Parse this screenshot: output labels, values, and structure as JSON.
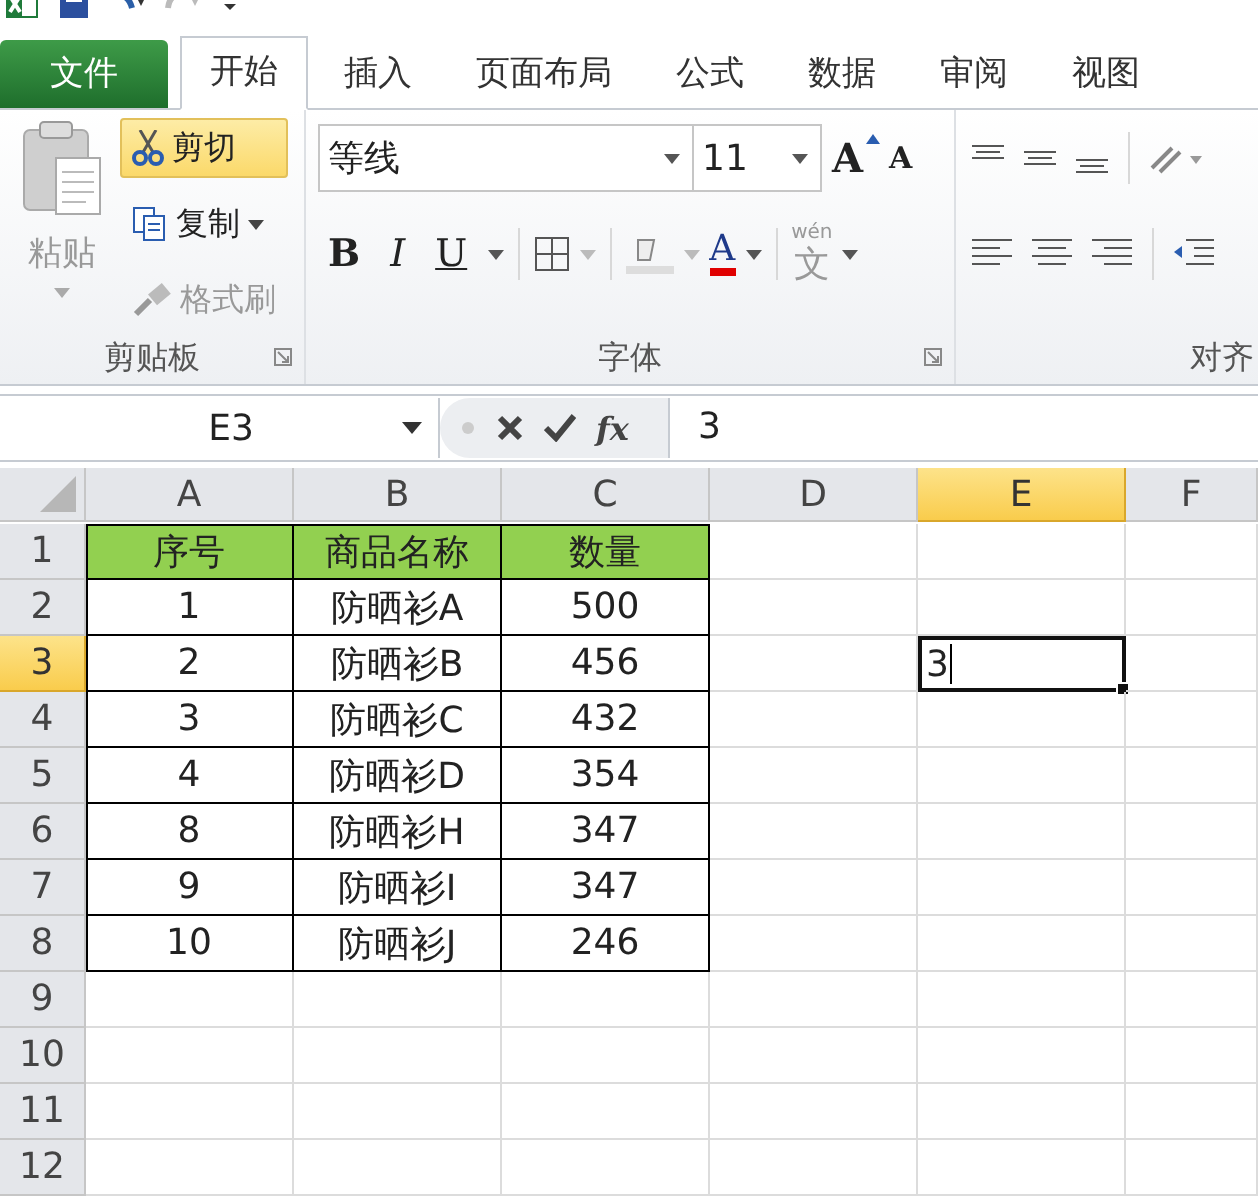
{
  "tabs": [
    {
      "label": "文件",
      "kind": "file",
      "selected": false
    },
    {
      "label": "开始",
      "kind": "tab",
      "selected": true
    },
    {
      "label": "插入",
      "kind": "tab",
      "selected": false
    },
    {
      "label": "页面布局",
      "kind": "tab",
      "selected": false
    },
    {
      "label": "公式",
      "kind": "tab",
      "selected": false
    },
    {
      "label": "数据",
      "kind": "tab",
      "selected": false
    },
    {
      "label": "审阅",
      "kind": "tab",
      "selected": false
    },
    {
      "label": "视图",
      "kind": "tab",
      "selected": false
    }
  ],
  "clipboard": {
    "title": "剪贴板",
    "paste": "粘贴",
    "cut": {
      "label": "剪切",
      "highlighted": true
    },
    "copy": "复制",
    "format_painter": {
      "label": "格式刷",
      "disabled": true
    }
  },
  "font": {
    "title": "字体",
    "font_name": "等线",
    "font_size": "11",
    "grow": "A",
    "shrink": "A",
    "bold": "B",
    "italic": "I",
    "underline": "U",
    "font_color": "A",
    "phonetic_top": "wén",
    "phonetic_char": "文"
  },
  "alignment": {
    "title": "对齐"
  },
  "formula_bar": {
    "name_box": "E3",
    "function_label": "fx",
    "value": "3"
  },
  "columns": [
    {
      "label": "A",
      "selected": false
    },
    {
      "label": "B",
      "selected": false
    },
    {
      "label": "C",
      "selected": false
    },
    {
      "label": "D",
      "selected": false
    },
    {
      "label": "E",
      "selected": true
    },
    {
      "label": "F",
      "selected": false
    }
  ],
  "rows": [
    {
      "label": "1",
      "kind": "header",
      "selected": false,
      "cells": [
        "序号",
        "商品名称",
        "数量"
      ]
    },
    {
      "label": "2",
      "kind": "data",
      "selected": false,
      "cells": [
        "1",
        "防晒衫A",
        "500"
      ]
    },
    {
      "label": "3",
      "kind": "data",
      "selected": true,
      "cells": [
        "2",
        "防晒衫B",
        "456"
      ],
      "entry": "3"
    },
    {
      "label": "4",
      "kind": "data",
      "selected": false,
      "cells": [
        "3",
        "防晒衫C",
        "432"
      ]
    },
    {
      "label": "5",
      "kind": "data",
      "selected": false,
      "cells": [
        "4",
        "防晒衫D",
        "354"
      ]
    },
    {
      "label": "6",
      "kind": "data",
      "selected": false,
      "cells": [
        "8",
        "防晒衫H",
        "347"
      ]
    },
    {
      "label": "7",
      "kind": "data",
      "selected": false,
      "cells": [
        "9",
        "防晒衫I",
        "347"
      ]
    },
    {
      "label": "8",
      "kind": "data",
      "selected": false,
      "cells": [
        "10",
        "防晒衫J",
        "246"
      ]
    },
    {
      "label": "9",
      "kind": "empty",
      "selected": false
    },
    {
      "label": "10",
      "kind": "empty",
      "selected": false
    },
    {
      "label": "11",
      "kind": "empty",
      "selected": false
    },
    {
      "label": "12",
      "kind": "empty",
      "selected": false
    }
  ]
}
